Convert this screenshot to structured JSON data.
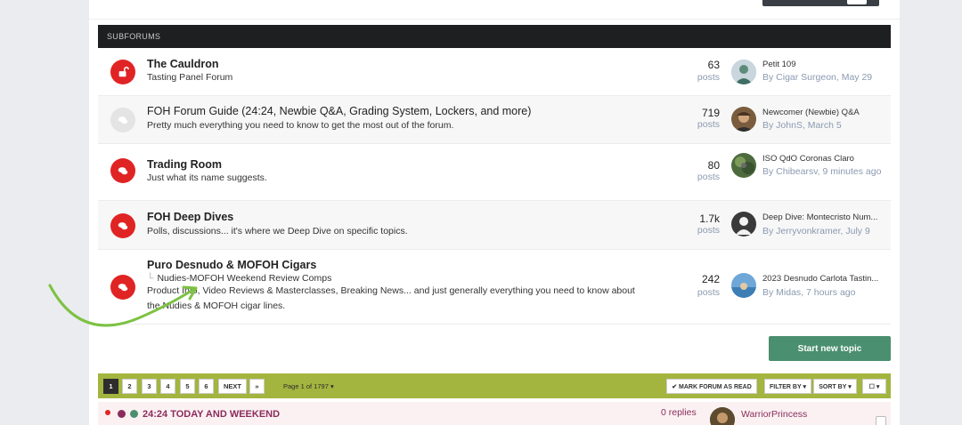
{
  "subforums_header": "SUBFORUMS",
  "forums": [
    {
      "title": "The Cauldron",
      "desc": "Tasting Panel Forum",
      "count": "63",
      "count_label": "posts",
      "last_title": "Petit 109",
      "last_by": "By Cigar Surgeon, May 29",
      "icon": "lock-open-icon"
    },
    {
      "title": "FOH Forum Guide (24:24, Newbie Q&A, Grading System, Lockers, and more)",
      "desc": "Pretty much everything you need to know to get the most out of the forum.",
      "count": "719",
      "count_label": "posts",
      "last_title": "Newcomer (Newbie) Q&A",
      "last_by": "By JohnS, March 5",
      "icon": "chat-bubbles-icon"
    },
    {
      "title": "Trading Room",
      "desc": "Just what its name suggests.",
      "count": "80",
      "count_label": "posts",
      "last_title": "ISO QdO Coronas Claro",
      "last_by": "By Chibearsv, 9 minutes ago",
      "icon": "chat-bubbles-icon"
    },
    {
      "title": "FOH Deep Dives",
      "desc": "Polls, discussions... it's where we Deep Dive on specific topics.",
      "count": "1.7k",
      "count_label": "posts",
      "last_title": "Deep Dive: Montecristo Num...",
      "last_by": "By Jerryvonkramer, July 9",
      "icon": "chat-bubbles-icon"
    },
    {
      "title": "Puro Desnudo & MOFOH Cigars",
      "subsub": "Nudies-MOFOH Weekend Review Comps",
      "desc": "Product Info, Video Reviews & Masterclasses, Breaking News... and just generally everything you need to know about the Nudies & MOFOH cigar lines.",
      "count": "242",
      "count_label": "posts",
      "last_title": "2023 Desnudo Carlota Tastin...",
      "last_by": "By Midas, 7 hours ago",
      "icon": "chat-bubbles-icon"
    }
  ],
  "start_new_topic": "Start new topic",
  "pagination": {
    "pages": [
      "1",
      "2",
      "3",
      "4",
      "5",
      "6"
    ],
    "next": "NEXT",
    "last": "»",
    "page_of": "Page 1 of 1797 ▾"
  },
  "toolbar": {
    "mark_read": "✔ MARK FORUM AS READ",
    "filter_by": "FILTER BY ▾",
    "sort_by": "SORT BY ▾",
    "select": "☐ ▾"
  },
  "topic": {
    "title": "24:24 TODAY AND WEEKEND",
    "replies": "0 replies",
    "user": "WarriorPrincess"
  },
  "colors": {
    "accent_red": "#e02424",
    "header_dark": "#1d1f21",
    "pager_green": "#a3b53f",
    "start_btn": "#4a8f6f",
    "arrow_green": "#7cc242"
  }
}
